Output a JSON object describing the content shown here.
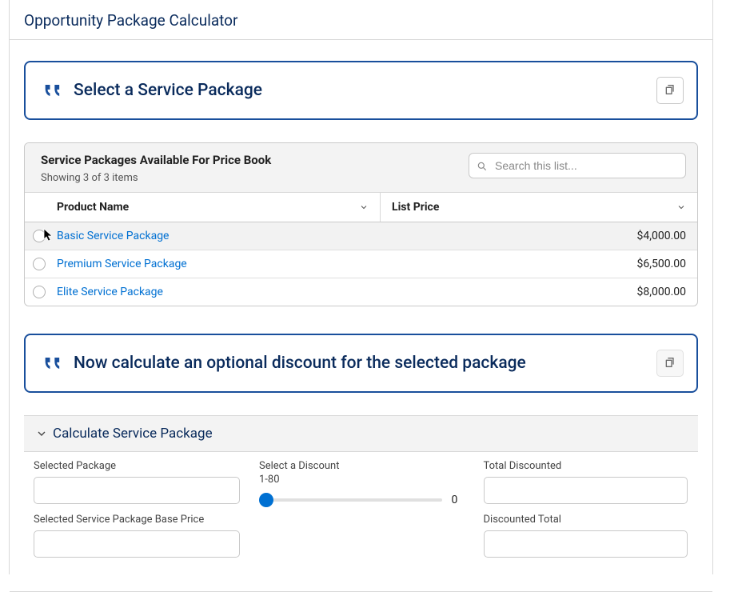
{
  "page_title": "Opportunity Package Calculator",
  "callout1": {
    "text": "Select a Service Package"
  },
  "callout2": {
    "text": "Now calculate an optional discount for the selected package"
  },
  "table": {
    "header_title": "Service Packages Available For Price Book",
    "header_sub": "Showing 3 of 3 items",
    "search_placeholder": "Search this list...",
    "col_product": "Product Name",
    "col_price": "List Price",
    "rows": [
      {
        "name": "Basic Service Package",
        "price": "$4,000.00"
      },
      {
        "name": "Premium Service Package",
        "price": "$6,500.00"
      },
      {
        "name": "Elite Service Package",
        "price": "$8,000.00"
      }
    ]
  },
  "section": {
    "title": "Calculate Service Package"
  },
  "form": {
    "selected_package_label": "Selected Package",
    "base_price_label": "Selected Service Package Base Price",
    "discount_label": "Select a Discount",
    "discount_range": "1-80",
    "discount_value": "0",
    "total_discounted_label": "Total Discounted",
    "discounted_total_label": "Discounted Total"
  }
}
